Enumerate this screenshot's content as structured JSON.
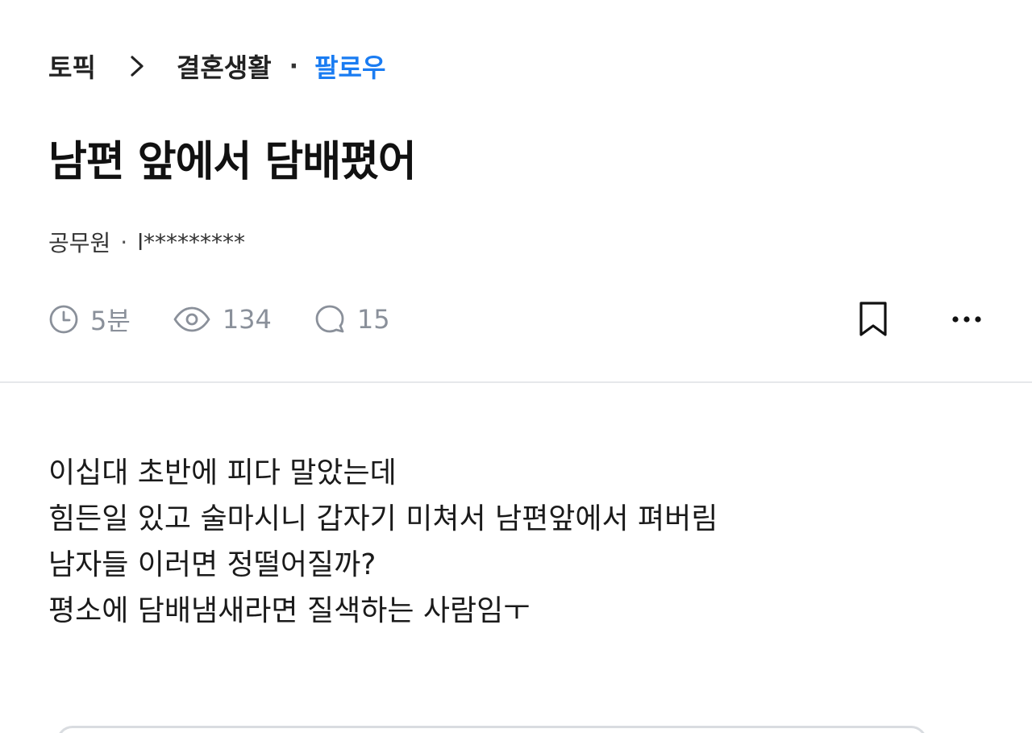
{
  "breadcrumb": {
    "root": "토픽",
    "topic": "결혼생활",
    "separator": "·",
    "follow_label": "팔로우"
  },
  "post": {
    "title": "남편 앞에서 담배폈어",
    "author_job": "공무원",
    "author_sep": "·",
    "author_id": "l*********"
  },
  "meta": {
    "time": "5분",
    "views": "134",
    "comments": "15"
  },
  "body": {
    "lines": [
      "이십대 초반에 피다 말았는데",
      "힘든일 있고 술마시니 갑자기 미쳐서 남편앞에서 펴버림",
      "남자들 이러면 정떨어질까?",
      "평소에 담배냄새라면 질색하는 사람임ㅜ"
    ]
  },
  "colors": {
    "accent": "#1a7cf2",
    "meta_gray": "#8a909a",
    "divider": "#e6e8eb"
  },
  "icons": {
    "chevron": "chevron-right-icon",
    "clock": "clock-icon",
    "eye": "eye-icon",
    "comment": "comment-icon",
    "bookmark": "bookmark-icon",
    "more": "more-icon"
  }
}
